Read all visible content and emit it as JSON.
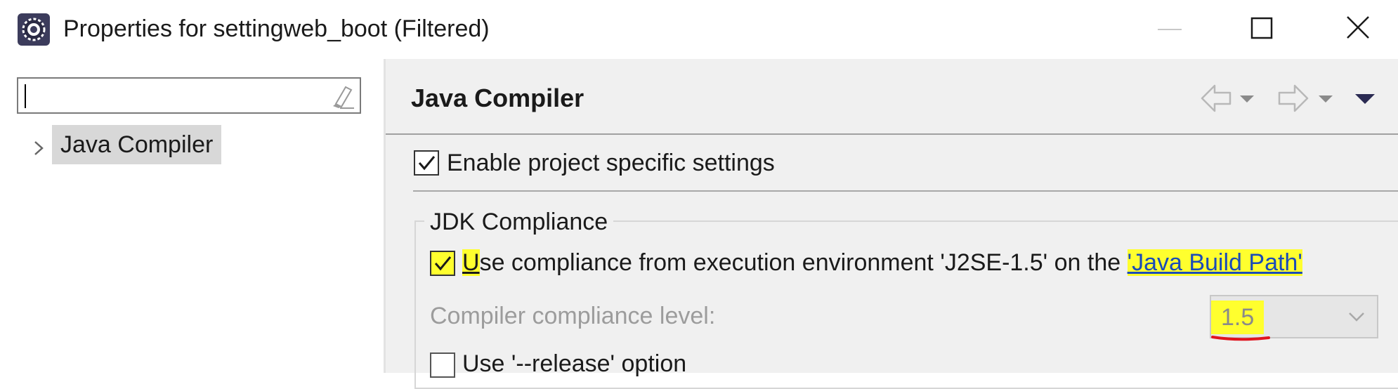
{
  "window": {
    "title": "Properties for settingweb_boot (Filtered)",
    "icons": {
      "app": "gear-icon",
      "minimize": "minimize-icon",
      "maximize": "maximize-icon",
      "close": "close-icon"
    }
  },
  "left_pane": {
    "filter": {
      "value": "",
      "placeholder": "",
      "clear_icon": "eraser-icon"
    },
    "tree": [
      {
        "label": "Java Compiler",
        "selected": true,
        "expand_icon": "chevron-right-icon"
      }
    ]
  },
  "page": {
    "title": "Java Compiler",
    "nav_icons": [
      "back-arrow-icon",
      "back-menu-icon",
      "forward-arrow-icon",
      "forward-menu-icon",
      "view-menu-icon"
    ],
    "enable_specific": {
      "label": "Enable project specific settings",
      "checked": true
    },
    "jdk_group": {
      "title": "JDK Compliance",
      "use_compliance": {
        "mnemonic": "U",
        "label_rest": "se compliance from execution environment 'J2SE-1.5' on the ",
        "link": "'Java Build Path'",
        "checked": true
      },
      "compliance_level": {
        "label": "Compiler compliance level:",
        "value": "1.5",
        "enabled": false
      },
      "release_option": {
        "label": "Use '--release' option",
        "checked": false
      }
    }
  },
  "colors": {
    "highlight": "#ffff2e",
    "annotation_red": "#e0141e",
    "link": "#1a4bb8",
    "disabled_text": "#9c9c9c",
    "pane_bg": "#f0f0f0"
  }
}
